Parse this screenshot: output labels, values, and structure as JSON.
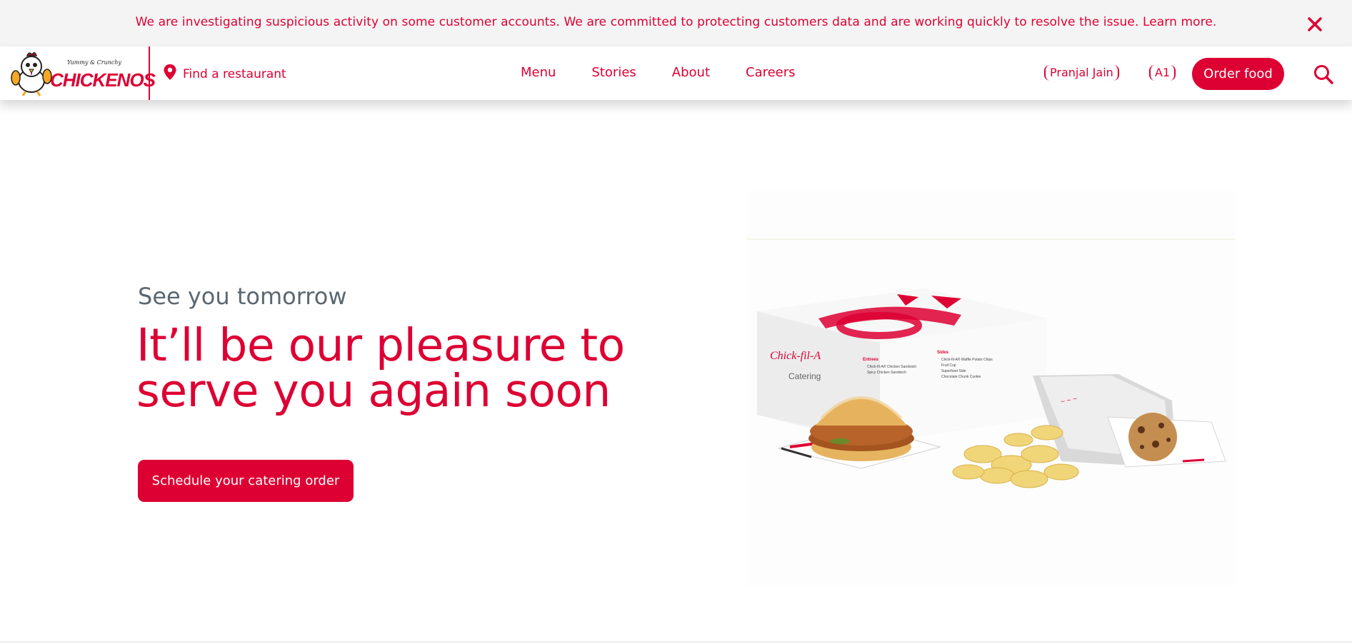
{
  "alert": {
    "message": "We are investigating suspicious activity on some customer accounts. We are committed to protecting customers data and are working quickly to resolve the issue. Learn more.",
    "close_icon": "close-icon"
  },
  "header": {
    "logo": {
      "tagline": "Yummy & Crunchy",
      "brand": "CHICKENOS"
    },
    "find_restaurant": "Find a restaurant",
    "nav": [
      "Menu",
      "Stories",
      "About",
      "Careers"
    ],
    "user_name": "Pranjal Jain",
    "user_badge": "A1",
    "order_button": "Order food",
    "search_icon": "search-icon"
  },
  "hero": {
    "eyebrow": "See you tomorrow",
    "headline": "It’ll be our pleasure to serve you again soon",
    "cta": "Schedule your catering order",
    "image_box": {
      "brand": "Chick-fil-A",
      "label": "Catering",
      "entrees_title": "Entrees",
      "entrees": [
        "Chick-fil-A® Chicken Sandwich",
        "Spicy Chicken Sandwich"
      ],
      "sides_title": "Sides",
      "sides": [
        "Chick-fil-A® Waffle Potato Chips",
        "Fruit Cup",
        "Superfood Side",
        "Chocolate Chunk Cookie"
      ]
    }
  },
  "colors": {
    "brand_red": "#dd0033",
    "alert_bg": "#f4f4f4",
    "eyebrow_gray": "#5b6770"
  }
}
